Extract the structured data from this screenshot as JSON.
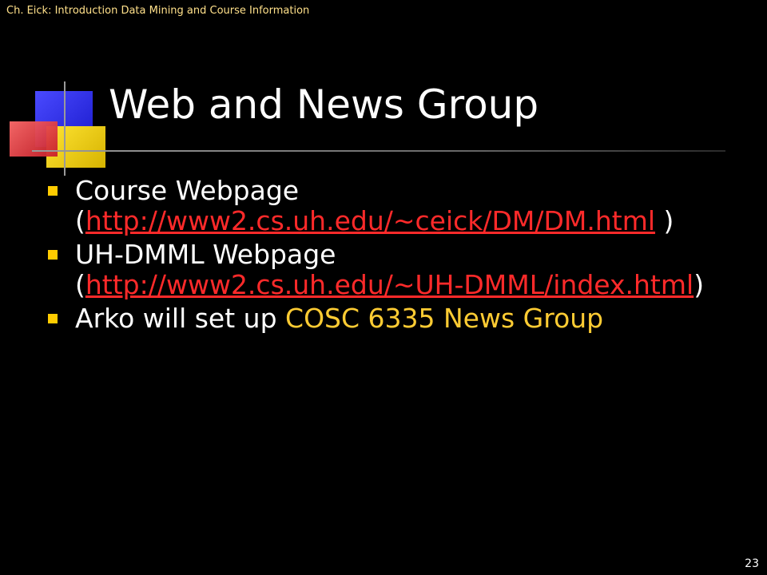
{
  "header": {
    "text": "Ch. Eick: Introduction Data Mining and Course Information"
  },
  "slide": {
    "title": "Web and News Group",
    "page_number": "23",
    "bullets": [
      {
        "line1": "Course Webpage",
        "open": "(",
        "link": "http://www2.cs.uh.edu/~ceick/DM/DM.html",
        "close": " )"
      },
      {
        "line1": "UH-DMML Webpage",
        "open": "(",
        "link": "http://www2.cs.uh.edu/~UH-DMML/index.html",
        "close": ")"
      },
      {
        "prefix": "Arko will set up ",
        "highlight": "COSC 6335 News Group"
      }
    ]
  },
  "colors": {
    "background": "#000000",
    "link": "#ff2a2a",
    "highlight": "#ffcc33",
    "bullet": "#ffcc00",
    "header": "#ffe08a"
  },
  "icons": {
    "bullet": "square-bullet-icon",
    "logo": "colored-squares-logo"
  }
}
